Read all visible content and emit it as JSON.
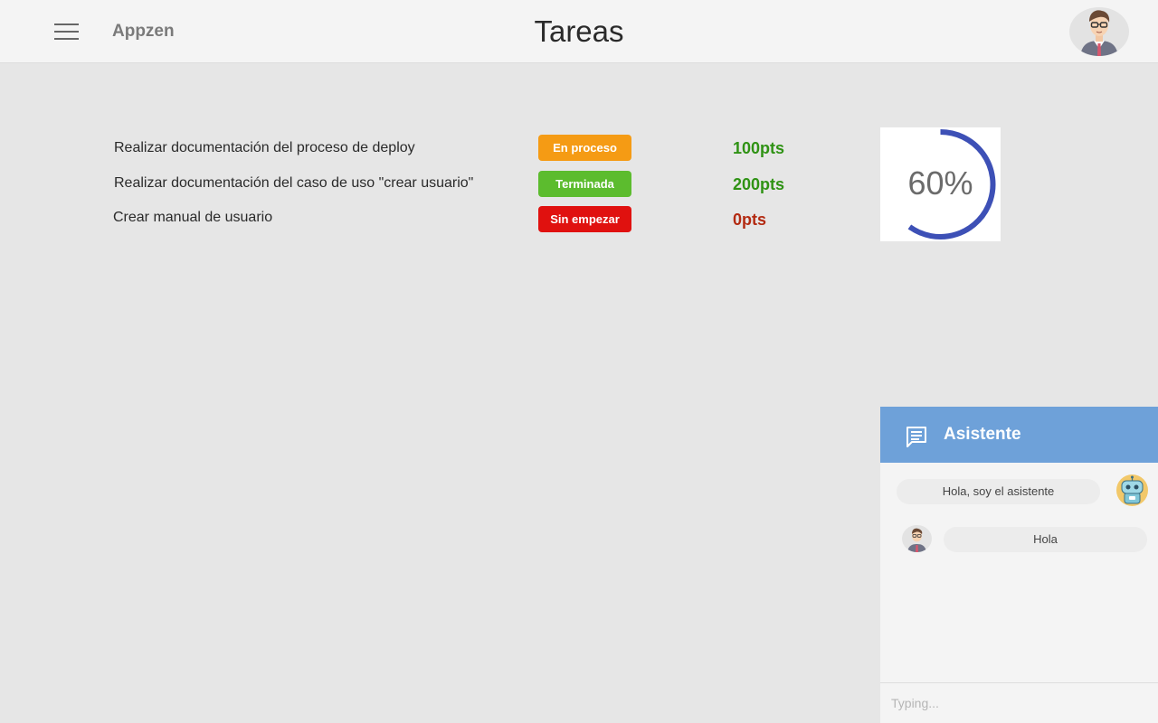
{
  "app": {
    "brand": "Appzen",
    "page_title": "Tareas"
  },
  "colors": {
    "in_progress": "#f59b14",
    "done": "#5cbc2e",
    "not_started": "#e0110f",
    "points_positive": "#2f9214",
    "points_zero": "#b32a11",
    "progress_arc": "#3d50b6",
    "chat_header": "#6ea1d9"
  },
  "tasks": [
    {
      "name": "Realizar documentación del proceso de deploy",
      "status": "En proceso",
      "points": "100pts"
    },
    {
      "name": "Realizar documentación del caso de uso \"crear usuario\"",
      "status": "Terminada",
      "points": "200pts"
    },
    {
      "name": "Crear manual de usuario",
      "status": "Sin empezar",
      "points": "0pts"
    }
  ],
  "progress": {
    "value": 60,
    "label": "60%"
  },
  "chat": {
    "title": "Asistente",
    "messages": [
      {
        "from": "bot",
        "text": "Hola, soy el asistente"
      },
      {
        "from": "user",
        "text": "Hola"
      }
    ],
    "input_placeholder": "Typing..."
  },
  "icons": {
    "menu": "hamburger-menu-icon",
    "chat": "chat-bubble-icon",
    "user": "user-avatar-icon",
    "bot": "robot-avatar-icon"
  }
}
